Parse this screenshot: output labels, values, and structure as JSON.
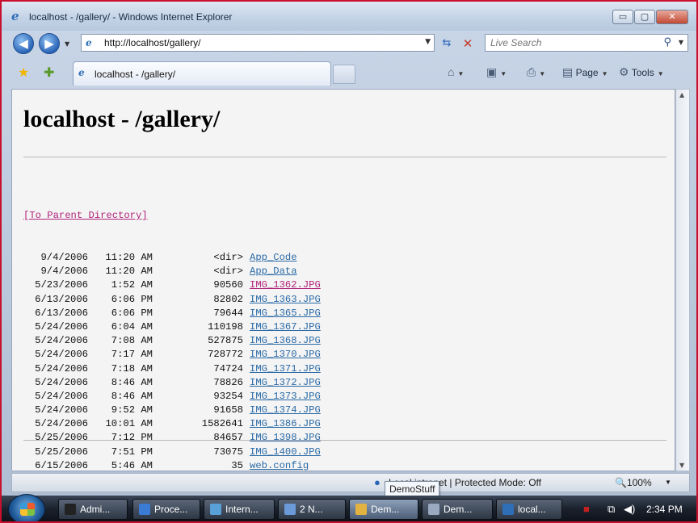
{
  "window": {
    "title": "localhost - /gallery/ - Windows Internet Explorer",
    "buttons": {
      "minimize": "▭",
      "maximize": "▢",
      "close": "✕"
    }
  },
  "nav": {
    "back_icon": "back-arrow-icon",
    "forward_icon": "forward-arrow-icon",
    "address": "http://localhost/gallery/",
    "search_placeholder": "Live Search"
  },
  "tabs": {
    "active_label": "localhost - /gallery/",
    "commands": {
      "page": "Page",
      "tools": "Tools"
    }
  },
  "page": {
    "heading": "localhost - /gallery/",
    "parent_link": "[To Parent Directory]",
    "entries": [
      {
        "date": "9/4/2006",
        "time": "11:20 AM",
        "size": "<dir>",
        "name": "App_Code",
        "visited": false
      },
      {
        "date": "9/4/2006",
        "time": "11:20 AM",
        "size": "<dir>",
        "name": "App_Data",
        "visited": false
      },
      {
        "date": "5/23/2006",
        "time": "1:52 AM",
        "size": "90560",
        "name": "IMG_1362.JPG",
        "visited": true
      },
      {
        "date": "6/13/2006",
        "time": "6:06 PM",
        "size": "82802",
        "name": "IMG_1363.JPG",
        "visited": false
      },
      {
        "date": "6/13/2006",
        "time": "6:06 PM",
        "size": "79644",
        "name": "IMG_1365.JPG",
        "visited": false
      },
      {
        "date": "5/24/2006",
        "time": "6:04 AM",
        "size": "110198",
        "name": "IMG_1367.JPG",
        "visited": false
      },
      {
        "date": "5/24/2006",
        "time": "7:08 AM",
        "size": "527875",
        "name": "IMG_1368.JPG",
        "visited": false
      },
      {
        "date": "5/24/2006",
        "time": "7:17 AM",
        "size": "728772",
        "name": "IMG_1370.JPG",
        "visited": false
      },
      {
        "date": "5/24/2006",
        "time": "7:18 AM",
        "size": "74724",
        "name": "IMG_1371.JPG",
        "visited": false
      },
      {
        "date": "5/24/2006",
        "time": "8:46 AM",
        "size": "78826",
        "name": "IMG_1372.JPG",
        "visited": false
      },
      {
        "date": "5/24/2006",
        "time": "8:46 AM",
        "size": "93254",
        "name": "IMG_1373.JPG",
        "visited": false
      },
      {
        "date": "5/24/2006",
        "time": "9:52 AM",
        "size": "91658",
        "name": "IMG_1374.JPG",
        "visited": false
      },
      {
        "date": "5/24/2006",
        "time": "10:01 AM",
        "size": "1582641",
        "name": "IMG_1386.JPG",
        "visited": false
      },
      {
        "date": "5/25/2006",
        "time": "7:12 PM",
        "size": "84657",
        "name": "IMG_1398.JPG",
        "visited": false
      },
      {
        "date": "5/25/2006",
        "time": "7:51 PM",
        "size": "73075",
        "name": "IMG_1400.JPG",
        "visited": false
      },
      {
        "date": "6/15/2006",
        "time": "5:46 AM",
        "size": "35",
        "name": "web.config",
        "visited": false
      }
    ]
  },
  "status": {
    "zone": "Local intranet | Protected Mode: Off",
    "zoom": "100%",
    "tooltip": "DemoStuff"
  },
  "taskbar": {
    "items": [
      {
        "label": "Admi...",
        "icon": "cmd-icon",
        "color": "#222222"
      },
      {
        "label": "Proce...",
        "icon": "process-explorer-icon",
        "color": "#3a7bd5"
      },
      {
        "label": "Intern...",
        "icon": "iis-manager-icon",
        "color": "#5aa0d8"
      },
      {
        "label": "2 N...",
        "icon": "notepad-icon",
        "color": "#6a9bd8"
      },
      {
        "label": "Dem...",
        "icon": "folder-icon",
        "color": "#e3b341"
      },
      {
        "label": "Dem...",
        "icon": "visual-studio-icon",
        "color": "#9aa9c0"
      },
      {
        "label": "local...",
        "icon": "internet-explorer-icon",
        "color": "#2f6fb8"
      }
    ],
    "clock": "2:34 PM"
  },
  "colors": {
    "link": "#2a6aa6",
    "visited_link": "#b0237a",
    "page_background": "#f4f4f4"
  }
}
